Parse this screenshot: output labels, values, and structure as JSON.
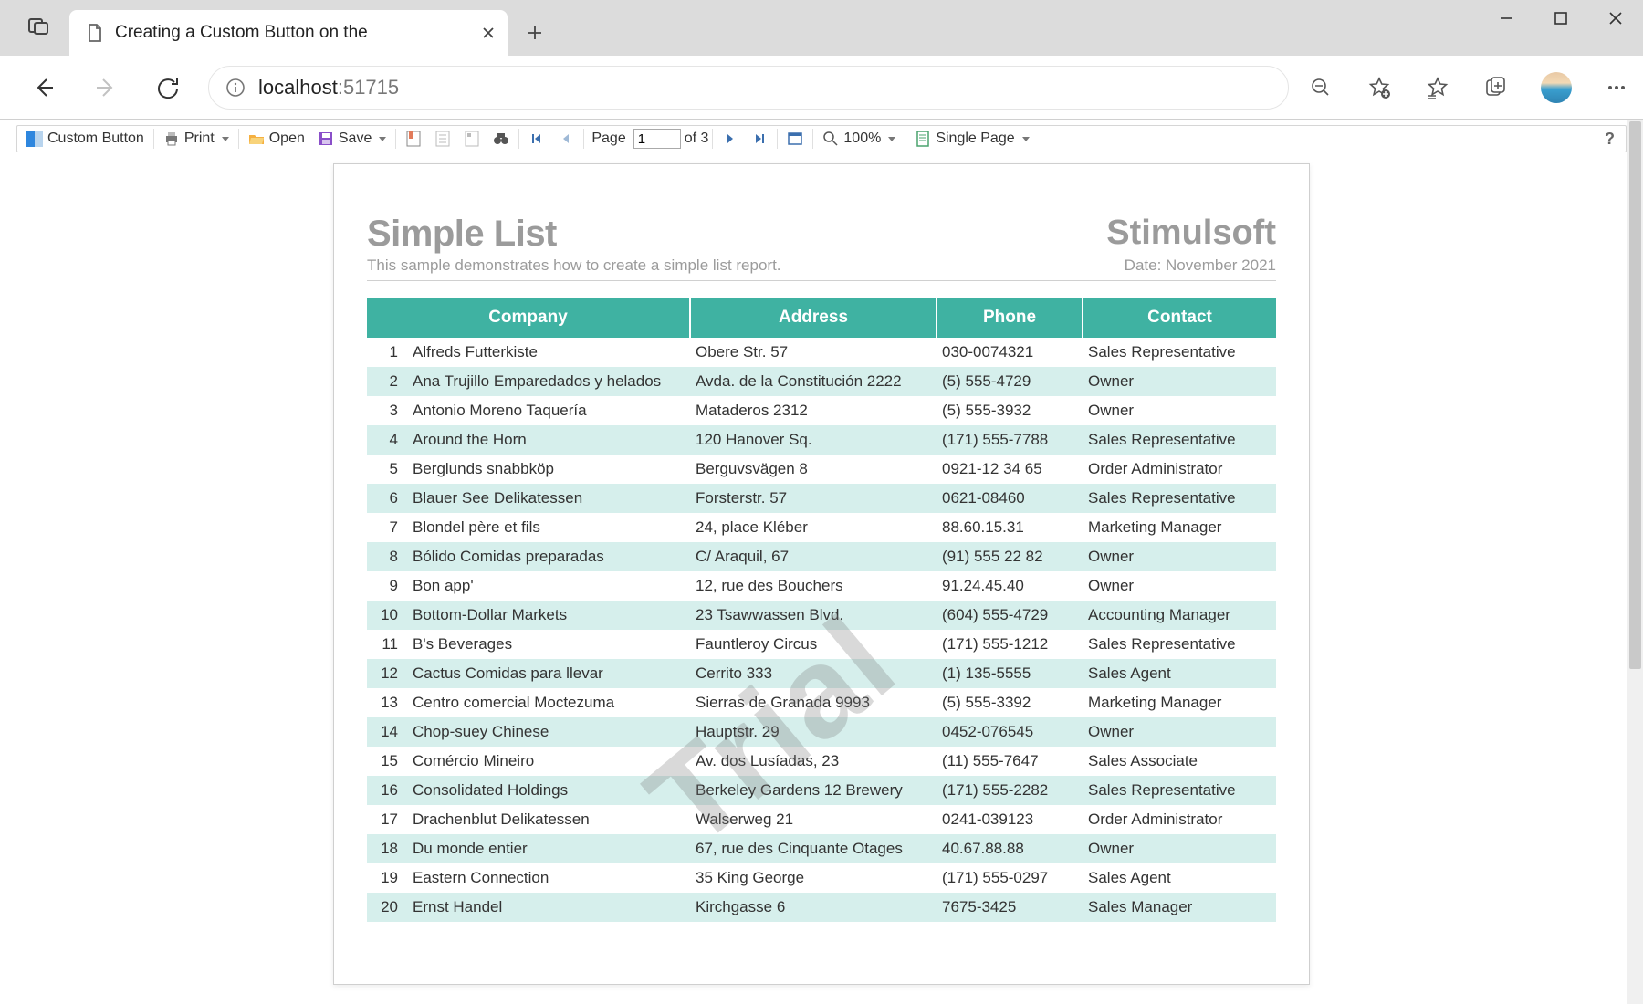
{
  "browser": {
    "tab_title": "Creating a Custom Button on the",
    "url_prefix": "localhost",
    "url_suffix": ":51715"
  },
  "toolbar": {
    "custom_button": "Custom Button",
    "print": "Print",
    "open": "Open",
    "save": "Save",
    "page_label": "Page",
    "page_current": "1",
    "page_of": "of 3",
    "zoom": "100%",
    "view_mode": "Single Page",
    "help": "?"
  },
  "report": {
    "title": "Simple List",
    "brand": "Stimulsoft",
    "subtitle": "This sample demonstrates how to create a simple list report.",
    "date": "Date: November 2021",
    "watermark": "Trial",
    "columns": {
      "company": "Company",
      "address": "Address",
      "phone": "Phone",
      "contact": "Contact"
    },
    "rows": [
      {
        "n": "1",
        "company": "Alfreds Futterkiste",
        "address": "Obere Str. 57",
        "phone": "030-0074321",
        "contact": "Sales Representative"
      },
      {
        "n": "2",
        "company": "Ana Trujillo Emparedados y helados",
        "address": "Avda. de la Constitución 2222",
        "phone": "(5) 555-4729",
        "contact": "Owner"
      },
      {
        "n": "3",
        "company": "Antonio Moreno Taquería",
        "address": "Mataderos  2312",
        "phone": "(5) 555-3932",
        "contact": "Owner"
      },
      {
        "n": "4",
        "company": "Around the Horn",
        "address": "120 Hanover Sq.",
        "phone": "(171) 555-7788",
        "contact": "Sales Representative"
      },
      {
        "n": "5",
        "company": "Berglunds snabbköp",
        "address": "Berguvsvägen  8",
        "phone": "0921-12 34 65",
        "contact": "Order Administrator"
      },
      {
        "n": "6",
        "company": "Blauer See Delikatessen",
        "address": "Forsterstr. 57",
        "phone": "0621-08460",
        "contact": "Sales Representative"
      },
      {
        "n": "7",
        "company": "Blondel père et fils",
        "address": "24, place Kléber",
        "phone": "88.60.15.31",
        "contact": "Marketing Manager"
      },
      {
        "n": "8",
        "company": "Bólido Comidas preparadas",
        "address": "C/ Araquil, 67",
        "phone": "(91) 555 22 82",
        "contact": "Owner"
      },
      {
        "n": "9",
        "company": "Bon app'",
        "address": "12, rue des Bouchers",
        "phone": "91.24.45.40",
        "contact": "Owner"
      },
      {
        "n": "10",
        "company": "Bottom-Dollar Markets",
        "address": "23 Tsawwassen Blvd.",
        "phone": "(604) 555-4729",
        "contact": "Accounting Manager"
      },
      {
        "n": "11",
        "company": "B's Beverages",
        "address": "Fauntleroy Circus",
        "phone": "(171) 555-1212",
        "contact": "Sales Representative"
      },
      {
        "n": "12",
        "company": "Cactus Comidas para llevar",
        "address": "Cerrito 333",
        "phone": "(1) 135-5555",
        "contact": "Sales Agent"
      },
      {
        "n": "13",
        "company": "Centro comercial Moctezuma",
        "address": "Sierras de Granada 9993",
        "phone": "(5) 555-3392",
        "contact": "Marketing Manager"
      },
      {
        "n": "14",
        "company": "Chop-suey Chinese",
        "address": "Hauptstr. 29",
        "phone": "0452-076545",
        "contact": "Owner"
      },
      {
        "n": "15",
        "company": "Comércio Mineiro",
        "address": "Av. dos Lusíadas, 23",
        "phone": "(11) 555-7647",
        "contact": "Sales Associate"
      },
      {
        "n": "16",
        "company": "Consolidated Holdings",
        "address": "Berkeley Gardens 12  Brewery",
        "phone": "(171) 555-2282",
        "contact": "Sales Representative"
      },
      {
        "n": "17",
        "company": "Drachenblut Delikatessen",
        "address": "Walserweg 21",
        "phone": "0241-039123",
        "contact": "Order Administrator"
      },
      {
        "n": "18",
        "company": "Du monde entier",
        "address": "67, rue des Cinquante Otages",
        "phone": "40.67.88.88",
        "contact": "Owner"
      },
      {
        "n": "19",
        "company": "Eastern Connection",
        "address": "35 King George",
        "phone": "(171) 555-0297",
        "contact": "Sales Agent"
      },
      {
        "n": "20",
        "company": "Ernst Handel",
        "address": "Kirchgasse 6",
        "phone": "7675-3425",
        "contact": "Sales Manager"
      }
    ]
  }
}
